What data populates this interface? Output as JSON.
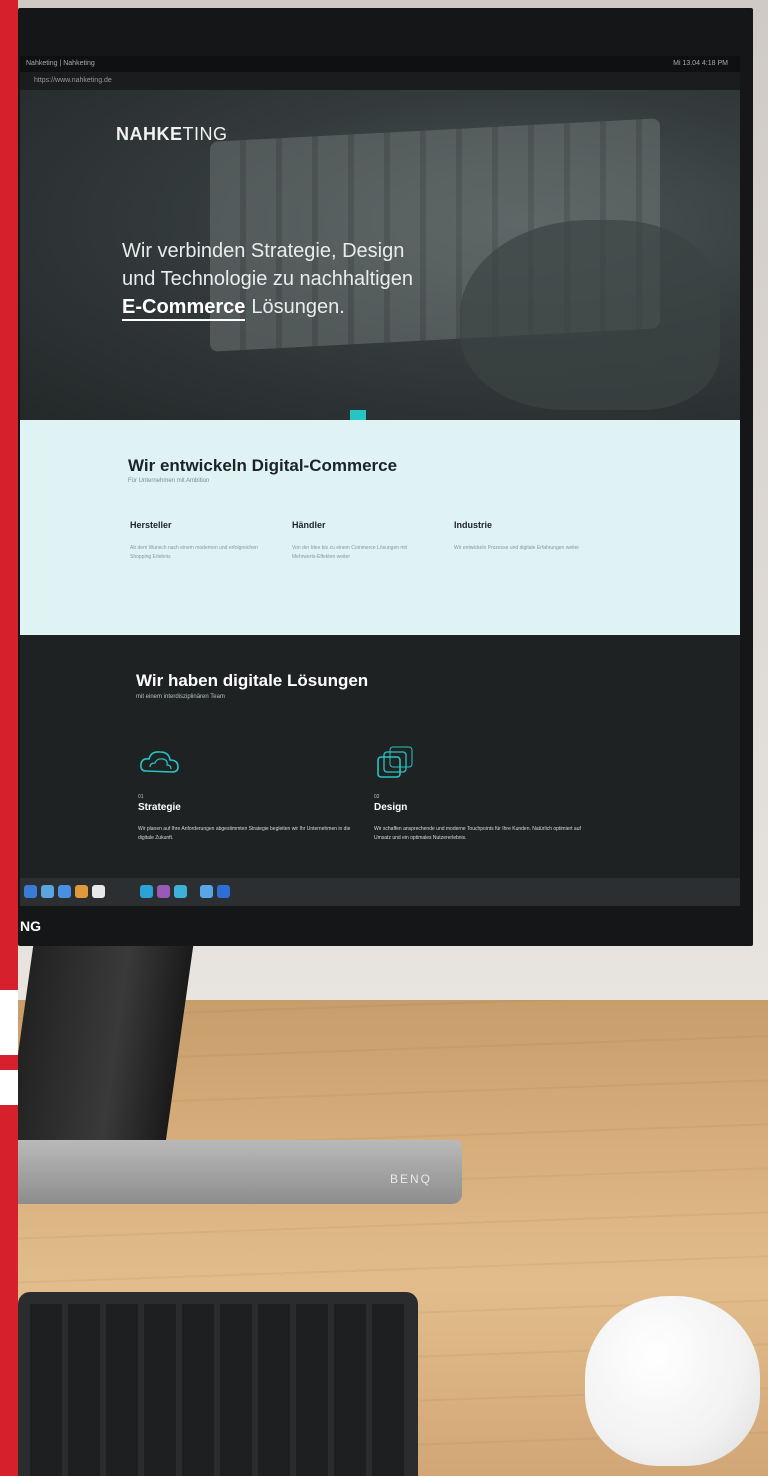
{
  "os": {
    "tab_title": "Nahketing | Nahketing",
    "url": "https://www.nahketing.de",
    "status": "Mi 13.04  4:18 PM"
  },
  "hero": {
    "logo_bold": "NAHKE",
    "logo_light": "TING",
    "line1": "Wir verbinden Strategie, Design",
    "line2": "und Technologie zu nachhaltigen",
    "line3_em": "E-Commerce",
    "line3_rest": "Lösungen."
  },
  "develop": {
    "title": "Wir entwickeln Digital-Commerce",
    "subtitle": "Für Unternehmen mit Ambition",
    "columns": [
      {
        "heading": "Hersteller",
        "text": "Ab dem Wunsch nach einem modernen und erfolgreichen Shopping Erlebnis"
      },
      {
        "heading": "Händler",
        "text": "Von der Idee bis zu einem Commerce Lösungen mit Mehrwerts-Effekten weiter"
      },
      {
        "heading": "Industrie",
        "text": "Wir entwickeln Prozesse und digitale Erfahrungen weiter"
      }
    ]
  },
  "solutions": {
    "title": "Wir haben digitale Lösungen",
    "subtitle": "mit einem interdisziplinären Team",
    "items": [
      {
        "num": "01",
        "heading": "Strategie",
        "text": "Wir planen auf Ihre Anforderungen abgestimmten Strategie begleiten wir Ihr Unternehmen in die digitale Zukunft.",
        "icon": "cloud-outline-icon"
      },
      {
        "num": "02",
        "heading": "Design",
        "text": "Wir schaffen ansprechende und moderne Touchpoints für Ihre Kunden. Natürlich optimiert auf Umsatz und ein optimales Nutzererlebnis.",
        "icon": "stacked-squares-icon"
      }
    ]
  },
  "bezel_label": "NG",
  "stand_label": "BENQ",
  "colors": {
    "accent": "#27c4c4",
    "light_bg": "#dff3f4",
    "dark_bg": "#1f2223",
    "red_band": "#d6202c"
  }
}
